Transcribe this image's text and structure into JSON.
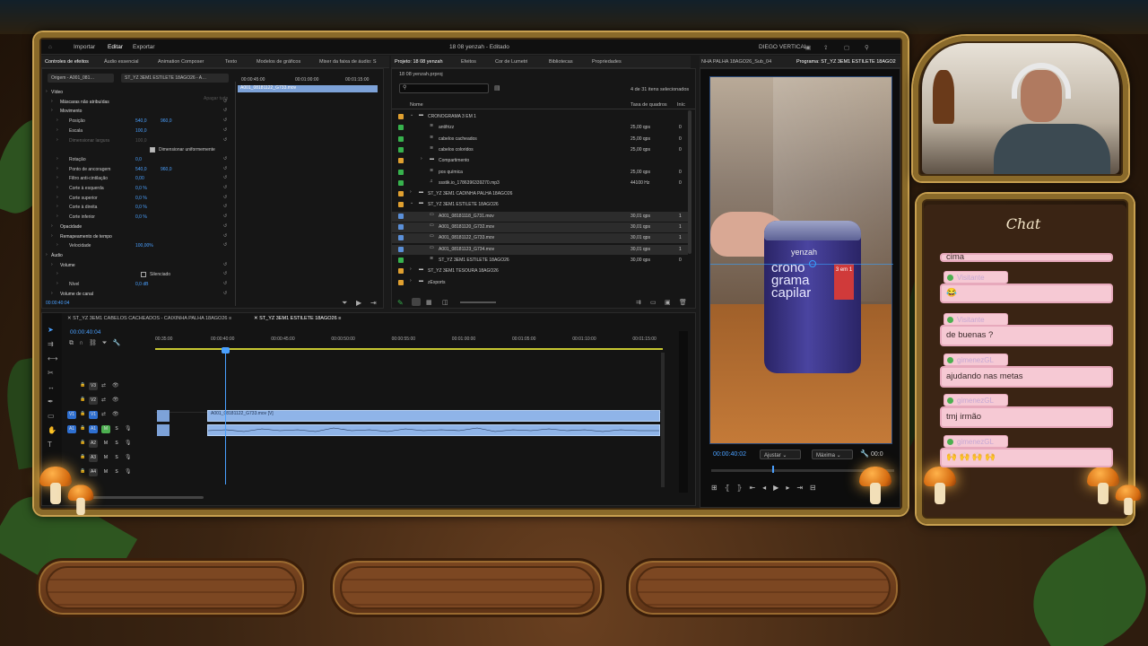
{
  "overlay": {
    "chat_title": "Chat"
  },
  "editor": {
    "workspaces": [
      "Importar",
      "Editar",
      "Exportar"
    ],
    "active_workspace": "Editar",
    "window_title": "18 08 yenzah - Editado",
    "workspace_name": "DIEGO VERTICAL",
    "effect_tabs": [
      "Controles de efeitos",
      "Áudio essencial",
      "Animation Composer",
      "Texto",
      "Modelos de gráficos",
      "Mixer da faixa de áudio: S"
    ],
    "source_label": "Origem - A001_081…",
    "seq_label": "ST_YZ 3EM1 ESTILETE 18AGO26 - A…",
    "timecodes_top": [
      "00:00:45:00",
      "00:01:00:00",
      "00:01:15:00"
    ],
    "clip_mini": "A001_08181122_G733.mov",
    "effects": [
      {
        "label": "Vídeo",
        "indent": 0
      },
      {
        "label": "Máscaras não atribuídas",
        "indent": 1
      },
      {
        "label": "Movimento",
        "indent": 1
      },
      {
        "label": "Posição",
        "indent": 2,
        "v1": "540,0",
        "v2": "960,0"
      },
      {
        "label": "Escala",
        "indent": 2,
        "v1": "100,0"
      },
      {
        "label": "Dimensionar largura",
        "indent": 2,
        "v1": "100,0",
        "dim": true
      },
      {
        "label": "Dimensionar uniformemente",
        "indent": 3,
        "check": true
      },
      {
        "label": "Rotação",
        "indent": 2,
        "v1": "0,0"
      },
      {
        "label": "Ponto de ancoragem",
        "indent": 2,
        "v1": "540,0",
        "v2": "960,0"
      },
      {
        "label": "Filtro anti-cintilação",
        "indent": 2,
        "v1": "0,00"
      },
      {
        "label": "Corte à esquerda",
        "indent": 2,
        "v1": "0,0 %"
      },
      {
        "label": "Corte superior",
        "indent": 2,
        "v1": "0,0 %"
      },
      {
        "label": "Corte à direita",
        "indent": 2,
        "v1": "0,0 %"
      },
      {
        "label": "Corte inferior",
        "indent": 2,
        "v1": "0,0 %"
      },
      {
        "label": "Opacidade",
        "indent": 1
      },
      {
        "label": "Remapeamento de tempo",
        "indent": 1
      },
      {
        "label": "Velocidade",
        "indent": 2,
        "v1": "100,00%"
      },
      {
        "label": "Áudio",
        "indent": 0
      },
      {
        "label": "Volume",
        "indent": 1
      },
      {
        "label": "Silenciado",
        "indent": 2,
        "check": false
      },
      {
        "label": "Nível",
        "indent": 2,
        "v1": "0,0 dB"
      },
      {
        "label": "Volume de canal",
        "indent": 1
      }
    ],
    "reset_label": "Apagar tudo",
    "effects_time": "00:00:40:04",
    "project_tabs": [
      "Projeto: 18 08 yenzah",
      "Efeitos",
      "Cor de Lumetri",
      "Bibliotecas",
      "Propriedades"
    ],
    "project_file": "18 08 yenzah.prproj",
    "selection_count": "4 de 31 itens selecionados",
    "project_cols": [
      "Nome",
      "Taxa de quadros",
      "Iníc"
    ],
    "project_items": [
      {
        "name": "CRONOGRAMA 3 EM 1",
        "color": "#e0a030",
        "type": "folder",
        "lvl": 0,
        "open": true
      },
      {
        "name": "antifrizz",
        "color": "#37b24d",
        "type": "seq",
        "lvl": 1,
        "fps": "25,00 qps",
        "start": "0"
      },
      {
        "name": "cabelos cacheados",
        "color": "#37b24d",
        "type": "seq",
        "lvl": 1,
        "fps": "25,00 qps",
        "start": "0"
      },
      {
        "name": "cabelos coloridos",
        "color": "#37b24d",
        "type": "seq",
        "lvl": 1,
        "fps": "25,00 qps",
        "start": "0"
      },
      {
        "name": "Compartimento",
        "color": "#e0a030",
        "type": "folder",
        "lvl": 1,
        "open": false
      },
      {
        "name": "pos química",
        "color": "#37b24d",
        "type": "seq",
        "lvl": 1,
        "fps": "25,00 qps",
        "start": "0"
      },
      {
        "name": "ssstik.io_1786396339270.mp3",
        "color": "#37b24d",
        "type": "audio",
        "lvl": 1,
        "fps": "44100 Hz",
        "start": "0"
      },
      {
        "name": "ST_YZ 3EM1 CADINHA PALHA 18AGO26",
        "color": "#e0a030",
        "type": "folder",
        "lvl": 0,
        "open": false
      },
      {
        "name": "ST_YZ 3EM1 ESTILETE 18AGO26",
        "color": "#e0a030",
        "type": "folder",
        "lvl": 0,
        "open": true
      },
      {
        "name": "A001_08181118_G731.mov",
        "color": "#5a8fd8",
        "type": "clip",
        "lvl": 1,
        "fps": "30,01 qps",
        "start": "1",
        "sel": true
      },
      {
        "name": "A001_08181120_G732.mov",
        "color": "#5a8fd8",
        "type": "clip",
        "lvl": 1,
        "fps": "30,01 qps",
        "start": "1",
        "sel": true
      },
      {
        "name": "A001_08181122_G733.mov",
        "color": "#5a8fd8",
        "type": "clip",
        "lvl": 1,
        "fps": "30,01 qps",
        "start": "1",
        "sel": true
      },
      {
        "name": "A001_08181123_G734.mov",
        "color": "#5a8fd8",
        "type": "clip",
        "lvl": 1,
        "fps": "30,01 qps",
        "start": "1",
        "sel": true
      },
      {
        "name": "ST_YZ 3EM1 ESTILETE 18AGO26",
        "color": "#37b24d",
        "type": "seq",
        "lvl": 1,
        "fps": "30,00 qps",
        "start": "0"
      },
      {
        "name": "ST_YZ 3EM1 TESOURA 18AGO26",
        "color": "#e0a030",
        "type": "folder",
        "lvl": 0,
        "open": false
      },
      {
        "name": "zExports",
        "color": "#e0a030",
        "type": "folder",
        "lvl": 0,
        "open": false
      }
    ],
    "program_title": "NHA PALHA 18AGO26_Sub_04",
    "program_label": "Programa: ST_YZ 3EM1 ESTILETE 18AGO2",
    "program_time": "00:00:40:02",
    "fit_label": "Ajustar",
    "quality_label": "Máxima",
    "program_time_right": "00:0",
    "product_brand": "yenzah",
    "product_line1": "crono",
    "product_line2": "grama",
    "product_line3": "capilar",
    "product_badge": "3 em 1",
    "seq_tabs": [
      "ST_YZ 3EM1 CABELOS CACHEADOS - CAIXINHA PALHA 18AGO26",
      "ST_YZ 3EM1 ESTILETE 18AGO26"
    ],
    "timeline_time": "00:00:40:04",
    "ruler": [
      "00:35:00",
      "00:00:40:00",
      "00:00:45:00",
      "00:00:50:00",
      "00:00:55:00",
      "00:01:00:00",
      "00:01:05:00",
      "00:01:10:00",
      "00:01:15:00"
    ],
    "tracks_v": [
      "V3",
      "V2",
      "V1"
    ],
    "tracks_a": [
      "A1",
      "A2",
      "A3",
      "A4"
    ],
    "clip_v_label": "A001_08181122_G733.mov [V]"
  },
  "chat": {
    "messages": [
      {
        "user": "Visitante",
        "text": "cima"
      },
      {
        "user": "Visitante",
        "text": "😂"
      },
      {
        "user": "Visitante",
        "text": "de buenas ?"
      },
      {
        "user": "gimenezGL",
        "text": "ajudando nas metas"
      },
      {
        "user": "gimenezGL",
        "text": "tmj irmão"
      },
      {
        "user": "gimenezGL",
        "text": "🙌 🙌 🙌 🙌"
      }
    ]
  }
}
